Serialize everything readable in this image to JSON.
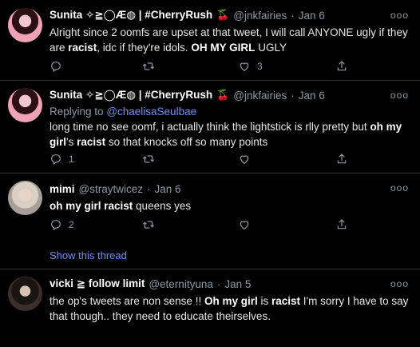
{
  "tweets": [
    {
      "name": "Sunita ✧≧◯Æ◍ | #CherryRush",
      "handle": "@jnkfairies",
      "date": "Jan 6",
      "text_parts": [
        "Alright since 2 oomfs are upset at that tweet, I will call ANYONE ugly if they are ",
        "racist",
        ", idc if they're idols. ",
        "OH MY GIRL",
        " UGLY"
      ],
      "replies": "",
      "retweets": "",
      "likes": "3"
    },
    {
      "name": "Sunita ✧≧◯Æ◍ | #CherryRush",
      "handle": "@jnkfairies",
      "date": "Jan 6",
      "replying_label": "Replying to",
      "replying_to": "@chaelisaSeulbae",
      "text_parts": [
        "long time no see oomf, i actually think the lightstick is rlly pretty but ",
        "oh my girl",
        "'s ",
        "racist",
        " so that knocks off so many points"
      ],
      "replies": "1",
      "retweets": "",
      "likes": ""
    },
    {
      "name": "mimi",
      "handle": "@straytwicez",
      "date": "Jan 6",
      "text_parts": [
        "oh my girl racist",
        " queens yes"
      ],
      "replies": "2",
      "retweets": "",
      "likes": ""
    },
    {
      "name": "vicki ≧ follow limit",
      "handle": "@eternityuna",
      "date": "Jan 5",
      "text_parts": [
        "the op's tweets are non sense !! ",
        "Oh my girl",
        " is ",
        "racist",
        " I'm sorry I have to say that though.. they need to educate theirselves."
      ]
    }
  ],
  "show_thread": "Show this thread",
  "cherry_glyph": "🍒",
  "more_glyph": "ooo",
  "colors": {
    "background": "#000000",
    "link": "#6e8ff0",
    "muted": "#8b98a5",
    "separator": "#2f3336"
  }
}
